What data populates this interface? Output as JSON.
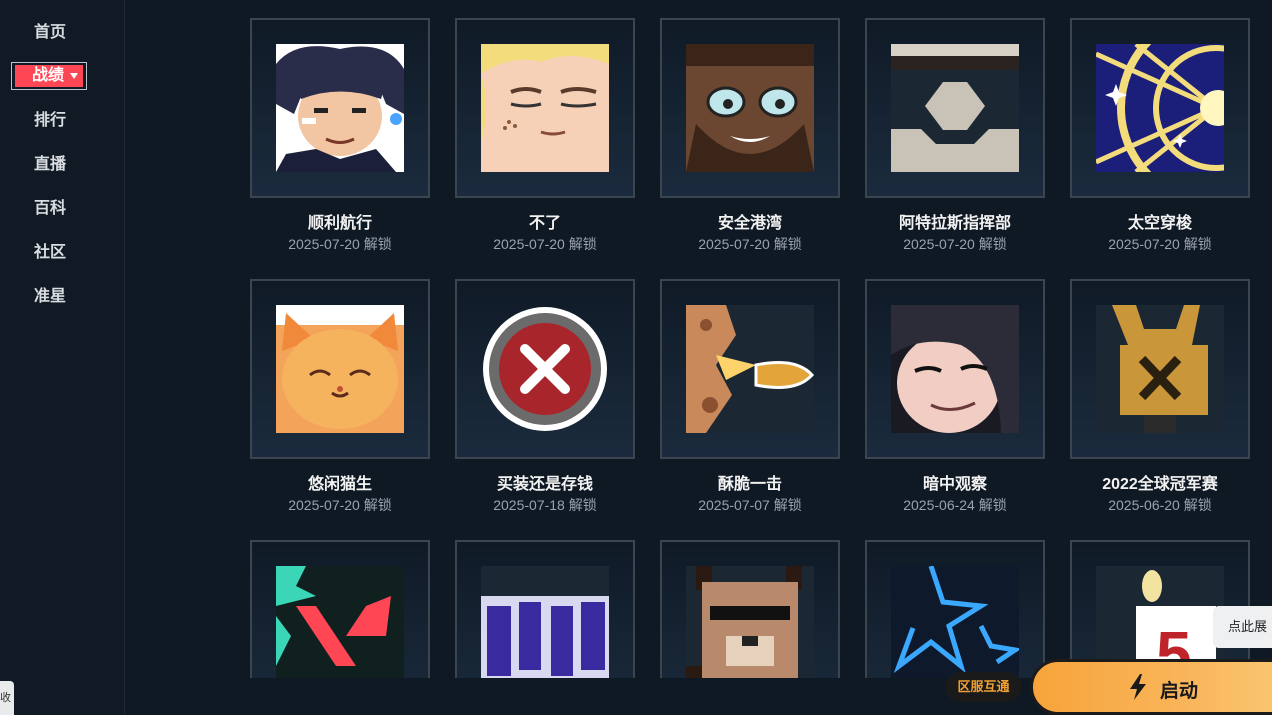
{
  "sidebar": {
    "items": [
      {
        "label": "首页"
      },
      {
        "label": "战绩"
      },
      {
        "label": "排行"
      },
      {
        "label": "直播"
      },
      {
        "label": "百科"
      },
      {
        "label": "社区"
      },
      {
        "label": "准星"
      }
    ],
    "active_index": 1,
    "side_tab_label": "收"
  },
  "cards": [
    {
      "title": "顺利航行",
      "date": "2025-07-20 解锁"
    },
    {
      "title": "不了",
      "date": "2025-07-20 解锁"
    },
    {
      "title": "安全港湾",
      "date": "2025-07-20 解锁"
    },
    {
      "title": "阿特拉斯指挥部",
      "date": "2025-07-20 解锁"
    },
    {
      "title": "太空穿梭",
      "date": "2025-07-20 解锁"
    },
    {
      "title": "悠闲猫生",
      "date": "2025-07-20 解锁"
    },
    {
      "title": "买装还是存钱",
      "date": "2025-07-18 解锁"
    },
    {
      "title": "酥脆一击",
      "date": "2025-07-07 解锁"
    },
    {
      "title": "暗中观察",
      "date": "2025-06-24 解锁"
    },
    {
      "title": "2022全球冠军赛",
      "date": "2025-06-20 解锁"
    },
    {
      "title": "",
      "date": ""
    },
    {
      "title": "",
      "date": ""
    },
    {
      "title": "",
      "date": ""
    },
    {
      "title": "",
      "date": ""
    },
    {
      "title": "",
      "date": ""
    }
  ],
  "footer": {
    "cross_server_label": "区服互通",
    "launch_label": "启动",
    "tooltip_label": "点此展"
  },
  "colors": {
    "accent": "#ff4655",
    "launch": "#f9b55a",
    "background": "#0f1923"
  }
}
